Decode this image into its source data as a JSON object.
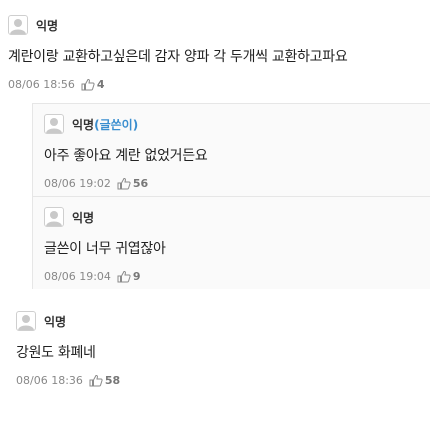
{
  "comments": [
    {
      "name": "익명",
      "text": "계란이랑 교환하고싶은데 감자 양파 각 두개씩 교환하고파요",
      "date": "08/06 18:56",
      "likes": "4"
    },
    {
      "name": "익명",
      "author_tag": "(글쓴이)",
      "text": "아주 좋아요 계란 없었거든요",
      "date": "08/06 19:02",
      "likes": "56"
    },
    {
      "name": "익명",
      "text": "글쓴이 너무 귀엽잖아",
      "date": "08/06 19:04",
      "likes": "9"
    },
    {
      "name": "익명",
      "text": "강원도 화폐네",
      "date": "08/06 18:36",
      "likes": "58"
    }
  ],
  "icons": {
    "avatar": "user-avatar-icon",
    "like": "thumbs-up-icon"
  },
  "colors": {
    "author_tag": "#3a8ecf",
    "meta": "#888888",
    "reply_bg": "#fafafa"
  }
}
